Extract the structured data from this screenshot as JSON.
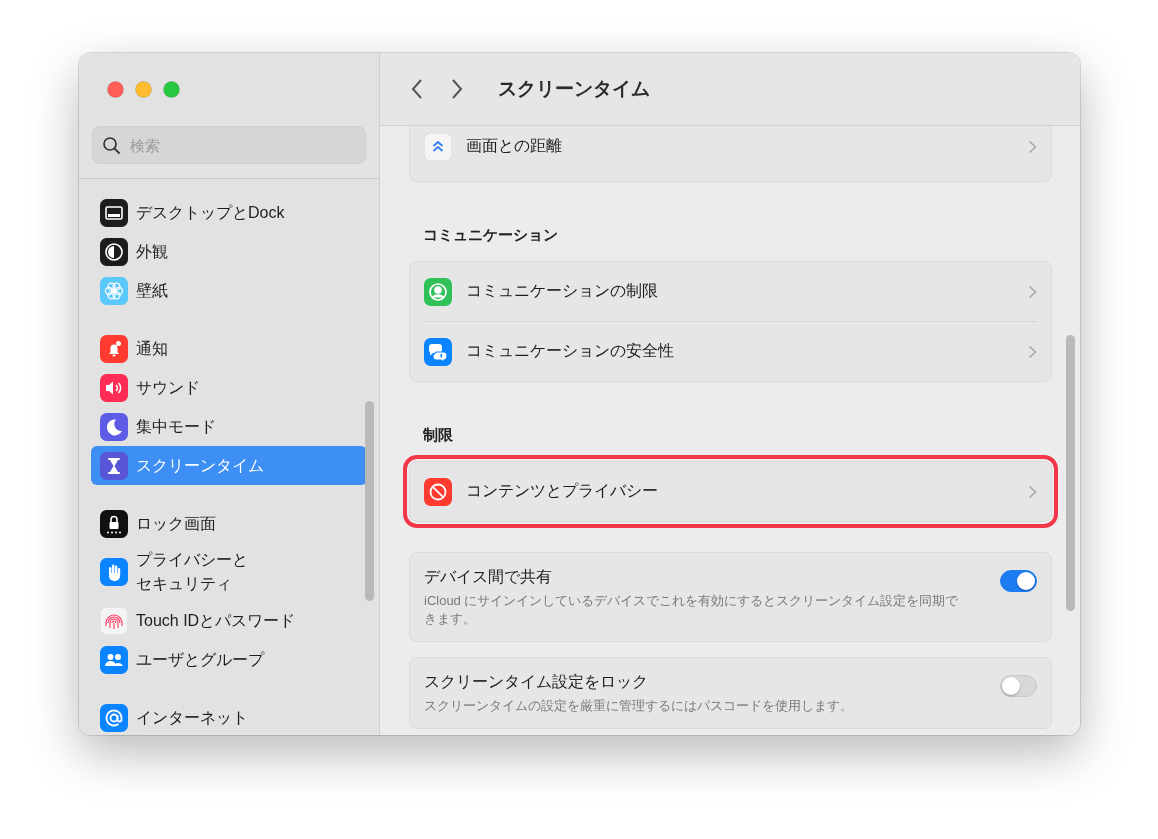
{
  "sidebar": {
    "search": {
      "placeholder": "検索"
    },
    "groups": [
      {
        "items": [
          {
            "label": "デスクトップとDock",
            "selected": false
          },
          {
            "label": "外観",
            "selected": false
          },
          {
            "label": "壁紙",
            "selected": false
          }
        ]
      },
      {
        "items": [
          {
            "label": "通知",
            "selected": false
          },
          {
            "label": "サウンド",
            "selected": false
          },
          {
            "label": "集中モード",
            "selected": false
          },
          {
            "label": "スクリーンタイム",
            "selected": true
          }
        ]
      },
      {
        "items": [
          {
            "label": "ロック画面",
            "selected": false
          },
          {
            "label": "プライバシーとセキュリティ",
            "selected": false
          },
          {
            "label": "Touch IDとパスワード",
            "selected": false
          },
          {
            "label": "ユーザとグループ",
            "selected": false
          }
        ]
      },
      {
        "items": [
          {
            "label": "インターネット",
            "selected": false
          }
        ]
      }
    ]
  },
  "header": {
    "title": "スクリーンタイム"
  },
  "sections": [
    {
      "cards": [
        {
          "kind": "links",
          "highlighted": false,
          "rows": [
            {
              "label": "画面との距離"
            }
          ]
        }
      ]
    },
    {
      "heading": "コミュニケーション",
      "cards": [
        {
          "kind": "links",
          "highlighted": false,
          "rows": [
            {
              "label": "コミュニケーションの制限"
            },
            {
              "label": "コミュニケーションの安全性"
            }
          ]
        }
      ]
    },
    {
      "heading": "制限",
      "cards": [
        {
          "kind": "links",
          "highlighted": true,
          "rows": [
            {
              "label": "コンテンツとプライバシー"
            }
          ]
        }
      ]
    },
    {
      "cards": [
        {
          "kind": "toggle",
          "title": "デバイス間で共有",
          "description": "iCloud にサインインしているデバイスでこれを有効にするとスクリーンタイム設定を同期できます。",
          "on": true
        },
        {
          "kind": "toggle",
          "title": "スクリーンタイム設定をロック",
          "description": "スクリーンタイムの設定を厳重に管理するにはパスコードを使用します。",
          "on": false
        }
      ]
    }
  ]
}
